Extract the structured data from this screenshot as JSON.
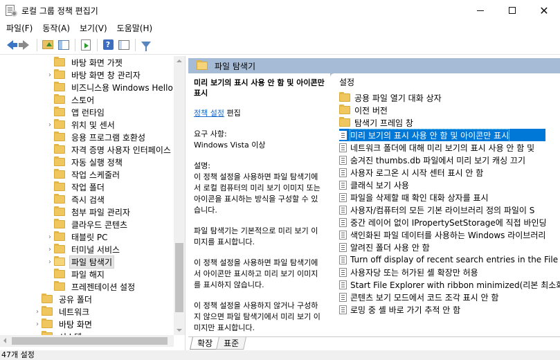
{
  "window": {
    "title": "로컬 그룹 정책 편집기",
    "controls": {
      "minimize": "—",
      "maximize": "☐",
      "close": "✕"
    }
  },
  "menubar": {
    "items": [
      "파일(F)",
      "동작(A)",
      "보기(V)",
      "도움말(H)"
    ]
  },
  "toolbar": {
    "buttons": [
      "back-icon",
      "forward-icon",
      "up-folder-icon",
      "show-hide-tree-icon",
      "export-list-icon",
      "help-icon",
      "view-icon",
      "filter-icon"
    ],
    "help_glyph": "?"
  },
  "tree": {
    "items": [
      {
        "label": "바탕 화면 가젯",
        "expandable": false
      },
      {
        "label": "바탕 화면 창 관리자",
        "expandable": true
      },
      {
        "label": "비즈니스용 Windows Hello",
        "expandable": false
      },
      {
        "label": "스토어",
        "expandable": false
      },
      {
        "label": "앱 런타임",
        "expandable": false
      },
      {
        "label": "위치 및 센서",
        "expandable": true
      },
      {
        "label": "응용 프로그램 호환성",
        "expandable": false
      },
      {
        "label": "자격 증명 사용자 인터페이스",
        "expandable": false
      },
      {
        "label": "자동 실행 정책",
        "expandable": false
      },
      {
        "label": "작업 스케줄러",
        "expandable": false
      },
      {
        "label": "작업 폴더",
        "expandable": false
      },
      {
        "label": "즉시 검색",
        "expandable": false
      },
      {
        "label": "첨부 파일 관리자",
        "expandable": false
      },
      {
        "label": "클라우드 콘텐츠",
        "expandable": false
      },
      {
        "label": "태블릿 PC",
        "expandable": true
      },
      {
        "label": "터미널 서비스",
        "expandable": true
      },
      {
        "label": "파일 탐색기",
        "expandable": true,
        "selected": true
      },
      {
        "label": "파일 해지",
        "expandable": false
      },
      {
        "label": "프레젠테이션 설정",
        "expandable": false
      }
    ],
    "lower_items": [
      {
        "label": "공유 폴더",
        "expandable": false
      },
      {
        "label": "네트워크",
        "expandable": true
      },
      {
        "label": "바탕 화면",
        "expandable": true
      },
      {
        "label": "시스템",
        "expandable": true
      }
    ],
    "expand_glyph": "›"
  },
  "right_pane": {
    "header": "파일 탐색기",
    "description": {
      "title": "미리 보기의 표시 사용 안 함 및 아이콘만 표시",
      "edit_link": "정책 설정",
      "edit_suffix": " 편집",
      "requirements_label": "요구 사항:",
      "requirements_value": "Windows Vista 이상",
      "desc_label": "설명:",
      "desc_p1": "이 정책 설정을 사용하면 파일 탐색기에서 로컬 컴퓨터의 미리 보기 이미지 또는 아이콘을 표시하는 방식을 구성할 수 있습니다.",
      "desc_p2": "파일 탐색기는 기본적으로 미리 보기 이미지를 표시합니다.",
      "desc_p3": "이 정책 설정을 사용하면 파일 탐색기에서 아이콘만 표시하고 미리 보기 이미지를 표시하지 않습니다.",
      "desc_p4": "이 정책 설정을 사용하지 않거나 구성하지 않으면 파일 탐색기에서 미리 보기 이미지만 표시합니다."
    },
    "list": {
      "header": "설정",
      "folders": [
        "공용 파일 열기 대화 상자",
        "이전 버전",
        "탐색기 프레임 창"
      ],
      "policies": [
        "미리 보기의 표시 사용 안 함 및 아이콘만 표시",
        "네트워크 폴더에 대해 미리 보기의 표시 사용 안 함 및",
        "숨겨진 thumbs.db 파일에서 미리 보기 캐싱 끄기",
        "사용자 로그온 시 시작 센터 표시 안 함",
        "클래식 보기 사용",
        "파일을 삭제할 때 확인 대화 상자를 표시",
        "사용자/컴퓨터의 모든 기본 라이브러리 정의 파일이 S",
        "중간 레이어 없이 IPropertySetStorage에 직접 바인딩",
        "색인화된 파일 데이터를 사용하는 Windows 라이브러리",
        "알려진 폴더 사용 안 함",
        "Turn off display of recent search entries in the File Ex",
        "사용자당 또는 허가된 셸 확장만 허용",
        "Start File Explorer with ribbon minimized(리본 최소화",
        "콘텐츠 보기 모드에서 코드 조각 표시 안 함",
        "로밍 중 셸 바로 가기 추적 안 함"
      ],
      "selected_index": 0
    },
    "tabs": [
      "확장",
      "표준"
    ]
  },
  "status": {
    "text": "47개 설정"
  }
}
